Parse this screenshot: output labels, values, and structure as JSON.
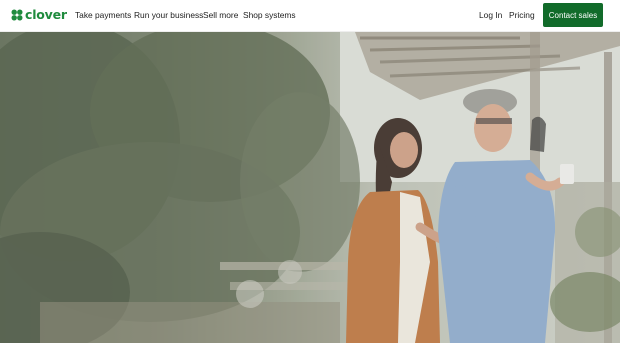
{
  "brand": {
    "name": "clover",
    "color": "#1f8b3d"
  },
  "nav": {
    "items": [
      {
        "label": "Take payments"
      },
      {
        "label": "Run your business"
      },
      {
        "label": "Sell more"
      },
      {
        "label": "Shop systems"
      }
    ],
    "login": "Log In",
    "pricing": "Pricing",
    "cta": {
      "label": "Contact sales",
      "color": "#116b2a"
    }
  },
  "hero": {
    "image": "garden-nursery-two-shoppers-photo"
  }
}
